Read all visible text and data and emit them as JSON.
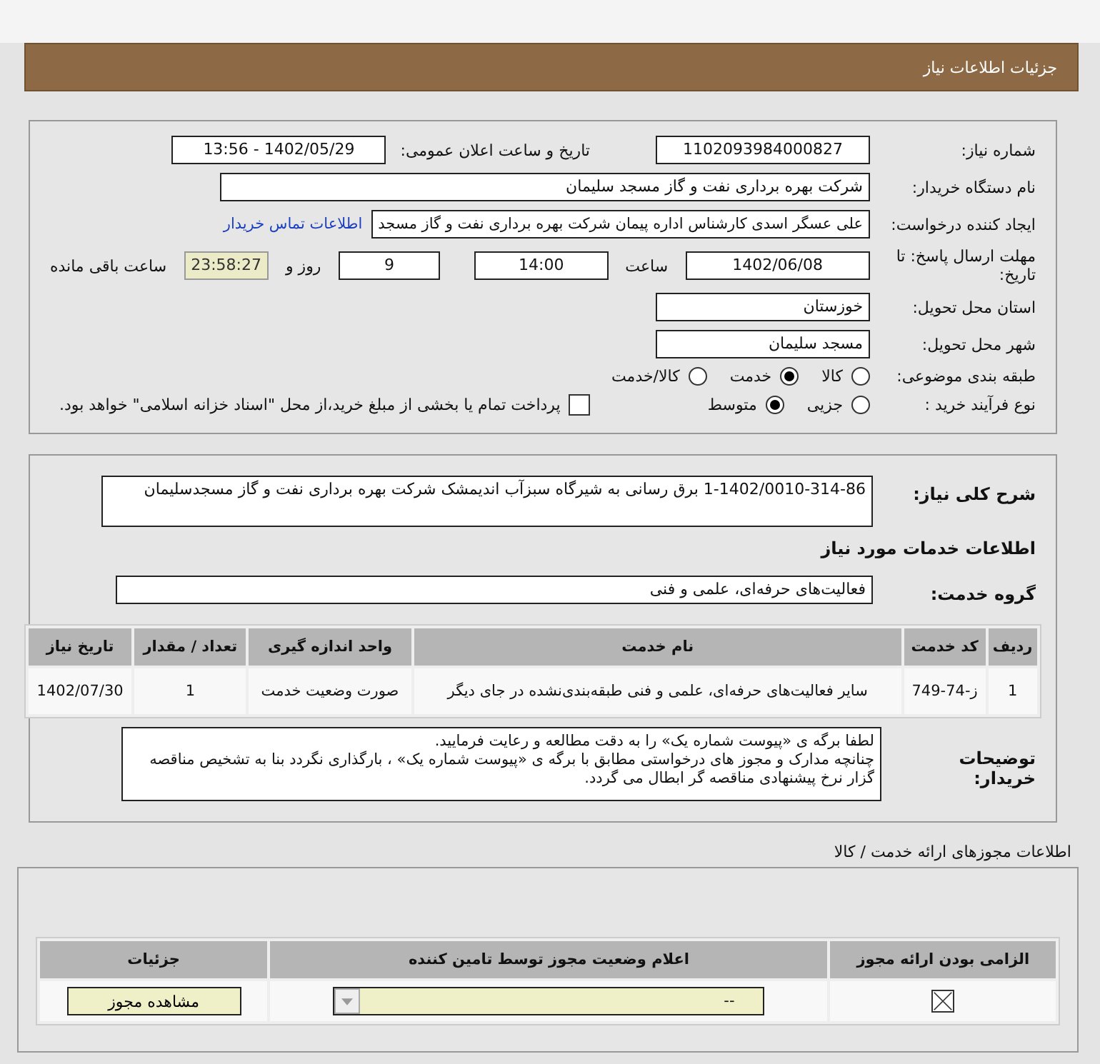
{
  "header": {
    "title": "جزئیات اطلاعات نیاز"
  },
  "need_number": {
    "label": "شماره نیاز:",
    "value": "1102093984000827"
  },
  "announce": {
    "label": "تاریخ و ساعت اعلان عمومی:",
    "value": "1402/05/29 - 13:56"
  },
  "buyer": {
    "label": "نام دستگاه خریدار:",
    "value": "شرکت بهره برداری نفت و گاز مسجد سلیمان"
  },
  "requester": {
    "label": "ایجاد کننده درخواست:",
    "value": "علی عسگر اسدی کارشناس اداره پیمان  شرکت بهره برداری نفت و گاز مسجد",
    "link": "اطلاعات تماس خریدار"
  },
  "deadline": {
    "label": "مهلت ارسال پاسخ: تا تاریخ:",
    "date": "1402/06/08",
    "time_label": "ساعت",
    "time": "14:00",
    "days": "9",
    "days_label": "روز و",
    "remaining": "23:58:27",
    "remaining_label": "ساعت باقی مانده"
  },
  "province": {
    "label": "استان محل تحویل:",
    "value": "خوزستان"
  },
  "city": {
    "label": "شهر محل تحویل:",
    "value": "مسجد سلیمان"
  },
  "category": {
    "label": "طبقه بندی موضوعی:",
    "options": [
      {
        "label": "کالا",
        "selected": false
      },
      {
        "label": "خدمت",
        "selected": true
      },
      {
        "label": "کالا/خدمت",
        "selected": false
      }
    ]
  },
  "purchase_type": {
    "label": "نوع فرآیند خرید :",
    "options": [
      {
        "label": "جزیی",
        "selected": false
      },
      {
        "label": "متوسط",
        "selected": true
      }
    ],
    "payment_checkbox": {
      "label": "پرداخت تمام یا بخشی از مبلغ خرید،از محل \"اسناد خزانه اسلامی\" خواهد بود.",
      "checked": false
    }
  },
  "summary": {
    "label": "شرح کلی نیاز:",
    "value": "1-1402/0010-314-86 برق رسانی به شیرگاه سبزآب اندیمشک شرکت بهره برداری نفت و گاز مسجدسلیمان"
  },
  "services_heading": "اطلاعات خدمات مورد نیاز",
  "service_group": {
    "label": "گروه خدمت:",
    "value": "فعالیت‌های حرفه‌ای، علمی و فنی"
  },
  "table": {
    "columns": [
      "ردیف",
      "کد خدمت",
      "نام خدمت",
      "واحد اندازه گیری",
      "تعداد / مقدار",
      "تاریخ نیاز"
    ],
    "rows": [
      [
        "1",
        "ز-74-749",
        "سایر فعالیت‌های حرفه‌ای، علمی و فنی طبقه‌بندی‌نشده در جای دیگر",
        "صورت وضعیت خدمت",
        "1",
        "1402/07/30"
      ]
    ]
  },
  "buyer_notes": {
    "label": "توضیحات خریدار:",
    "lines": [
      "لطفا برگه ی «پیوست شماره یک» را به دقت مطالعه و رعایت فرمایید.",
      "چنانچه مدارک و مجوز های درخواستی مطابق با برگه ی «پیوست شماره یک» ، بارگذاری نگردد بنا به تشخیص مناقصه گزار نرخ پیشنهادی مناقصه گر ابطال می گردد."
    ]
  },
  "licenses": {
    "heading": "اطلاعات مجوزهای ارائه خدمت / کالا",
    "columns": [
      "الزامی بودن ارائه مجوز",
      "اعلام وضعیت مجوز توسط تامین کننده",
      "جزئیات"
    ],
    "rows": [
      {
        "required": true,
        "status": "--",
        "button": "مشاهده مجوز"
      }
    ]
  }
}
